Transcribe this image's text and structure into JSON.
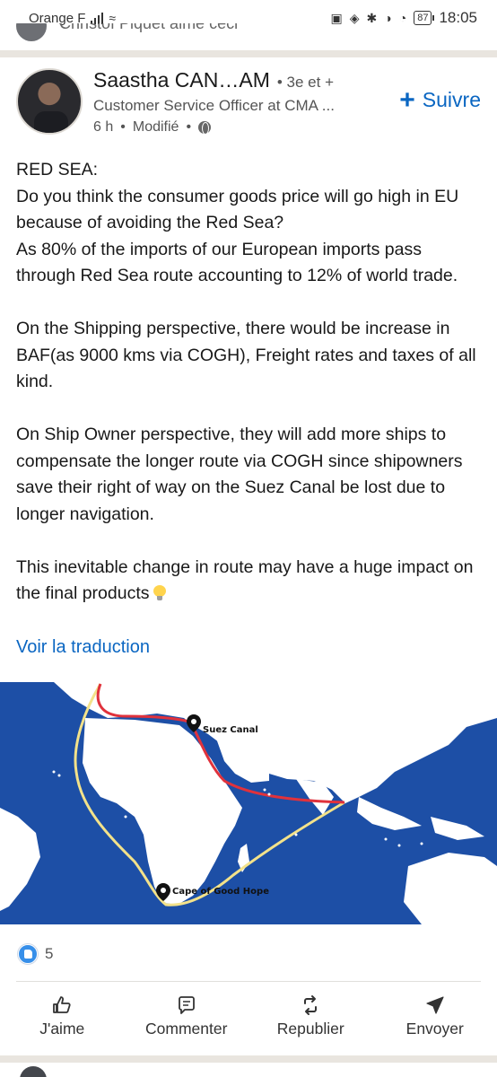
{
  "status_bar": {
    "carrier": "Orange F",
    "battery": "87",
    "time": "18:05"
  },
  "previous_post": {
    "cutoff_text": "Christof Piquet aime ceci"
  },
  "post": {
    "author_name": "Saastha CAN…AM",
    "degree": "• 3e et +",
    "headline": "Customer Service Officer at CMA ...",
    "time": "6 h",
    "edited": "Modifié",
    "follow_label": "Suivre",
    "body": [
      "RED SEA:\nDo you think the consumer goods price will go high in EU because of avoiding the Red Sea?\nAs 80% of the imports of our European imports pass through Red Sea route accounting to 12% of world trade.",
      "On the Shipping perspective, there would be increase in BAF(as 9000 kms via COGH), Freight rates  and taxes of all kind.",
      "On Ship Owner perspective, they will add more ships to compensate the longer route via COGH since shipowners save their right of way on the Suez Canal be lost due to longer navigation.",
      "This inevitable change in route may have a huge impact on the final products"
    ],
    "translate_label": "Voir la traduction",
    "map": {
      "suez_label": "Suez Canal",
      "cape_label": "Cape of Good Hope",
      "colors": {
        "ocean": "#1d4fa6",
        "land": "#ffffff",
        "red_sea_route": "#e0323c",
        "cape_route": "#f3e28a"
      }
    },
    "reactions_count": "5",
    "actions": {
      "like": "J'aime",
      "comment": "Commenter",
      "repost": "Republier",
      "send": "Envoyer"
    }
  },
  "colors": {
    "accent": "#0a66c2",
    "separator": "#e9e5df"
  }
}
